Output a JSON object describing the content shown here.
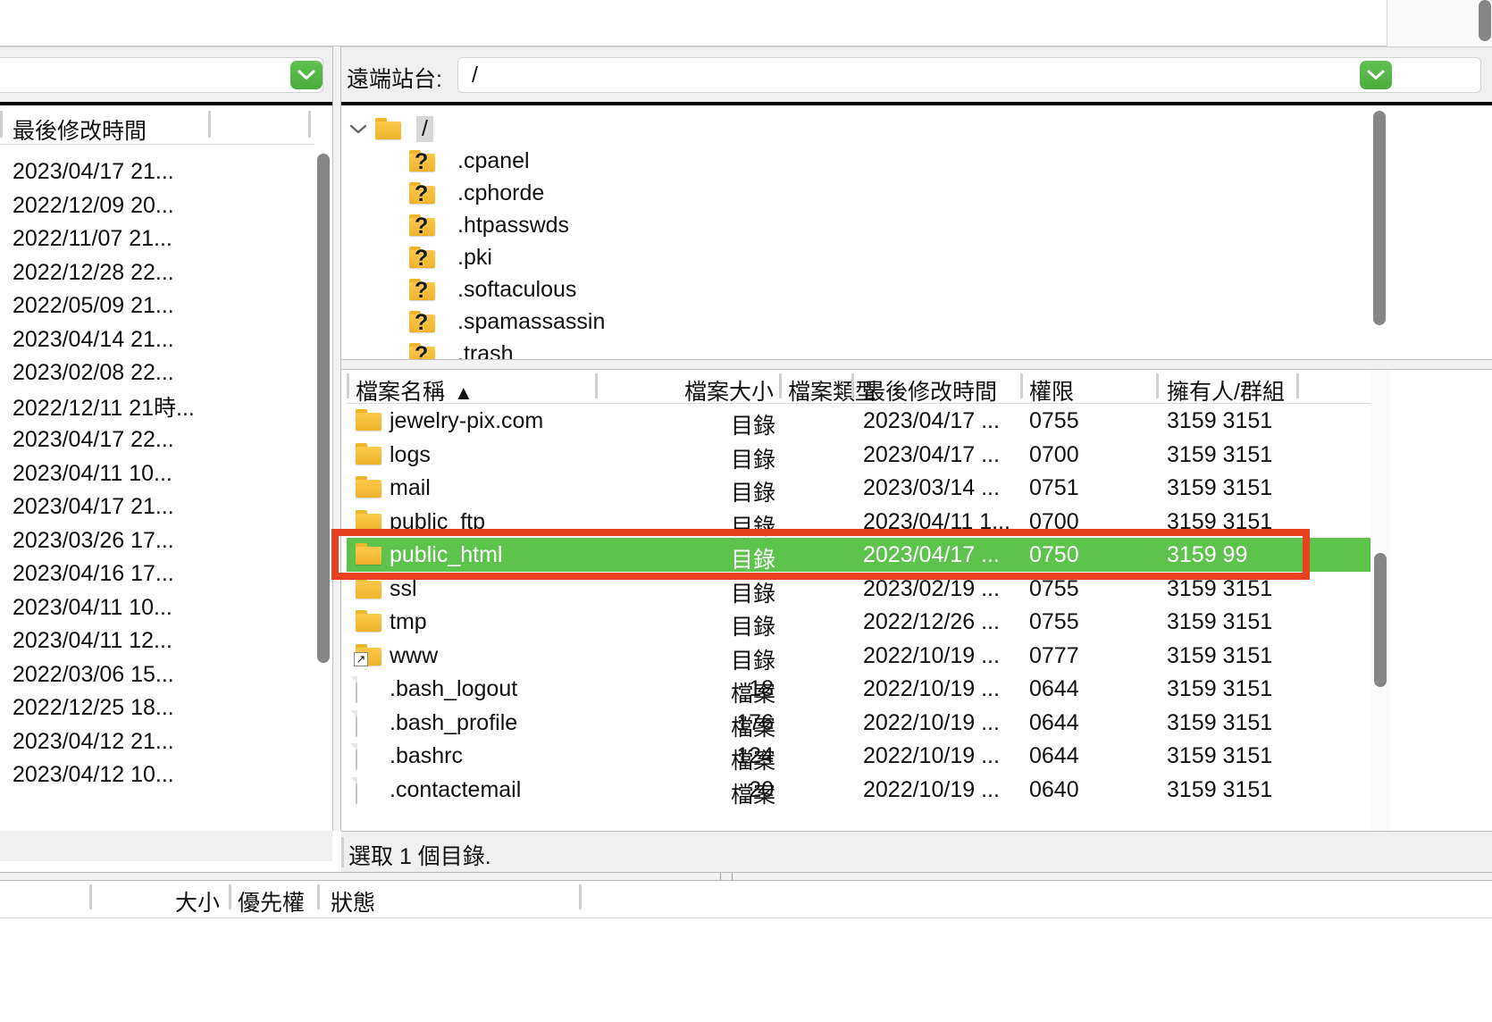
{
  "left_panel": {
    "combo_value": "",
    "dropdown_icon": "chevron-down-icon",
    "column_header": "最後修改時間",
    "rows": [
      "2023/04/17 21...",
      "2022/12/09 20...",
      "2022/11/07 21...",
      "2022/12/28 22...",
      "2022/05/09 21...",
      "2023/04/14 21...",
      "2023/02/08 22...",
      "2022/12/11 21時...",
      "2023/04/17 22...",
      "2023/04/11 10...",
      "2023/04/17 21...",
      "2023/03/26 17...",
      "2023/04/16 17...",
      "2023/04/11 10...",
      "2023/04/11 12...",
      "2022/03/06 15...",
      "2022/12/25 18...",
      "2023/04/12 21...",
      "2023/04/12 10..."
    ]
  },
  "remote": {
    "label": "遠端站台:",
    "path": "/",
    "dropdown_icon": "chevron-down-icon",
    "tree": [
      {
        "name": "/",
        "icon": "folder-icon",
        "selected": true,
        "expanded": true,
        "depth": 0
      },
      {
        "name": ".cpanel",
        "icon": "folder-unknown-icon",
        "selected": false,
        "depth": 1
      },
      {
        "name": ".cphorde",
        "icon": "folder-unknown-icon",
        "selected": false,
        "depth": 1
      },
      {
        "name": ".htpasswds",
        "icon": "folder-unknown-icon",
        "selected": false,
        "depth": 1
      },
      {
        "name": ".pki",
        "icon": "folder-unknown-icon",
        "selected": false,
        "depth": 1
      },
      {
        "name": ".softaculous",
        "icon": "folder-unknown-icon",
        "selected": false,
        "depth": 1
      },
      {
        "name": ".spamassassin",
        "icon": "folder-unknown-icon",
        "selected": false,
        "depth": 1
      },
      {
        "name": ".trash",
        "icon": "folder-unknown-icon",
        "selected": false,
        "depth": 1
      }
    ]
  },
  "file_list": {
    "columns": {
      "name": "檔案名稱",
      "size": "檔案大小",
      "type": "檔案類型",
      "modified": "最後修改時間",
      "permissions": "權限",
      "owner": "擁有人/群組"
    },
    "sort_indicator": "▲",
    "sort_column": "檔案名稱",
    "rows": [
      {
        "icon": "folder-icon",
        "name": "jewelry-pix.com",
        "size": "",
        "type": "目錄",
        "modified": "2023/04/17 ...",
        "permissions": "0755",
        "owner": "3159 3151",
        "selected": false
      },
      {
        "icon": "folder-icon",
        "name": "logs",
        "size": "",
        "type": "目錄",
        "modified": "2023/04/17 ...",
        "permissions": "0700",
        "owner": "3159 3151",
        "selected": false
      },
      {
        "icon": "folder-icon",
        "name": "mail",
        "size": "",
        "type": "目錄",
        "modified": "2023/03/14 ...",
        "permissions": "0751",
        "owner": "3159 3151",
        "selected": false
      },
      {
        "icon": "folder-icon",
        "name": "public_ftp",
        "size": "",
        "type": "目錄",
        "modified": "2023/04/11 1...",
        "permissions": "0700",
        "owner": "3159 3151",
        "selected": false
      },
      {
        "icon": "folder-icon",
        "name": "public_html",
        "size": "",
        "type": "目錄",
        "modified": "2023/04/17 ...",
        "permissions": "0750",
        "owner": "3159 99",
        "selected": true
      },
      {
        "icon": "folder-icon",
        "name": "ssl",
        "size": "",
        "type": "目錄",
        "modified": "2023/02/19 ...",
        "permissions": "0755",
        "owner": "3159 3151",
        "selected": false
      },
      {
        "icon": "folder-icon",
        "name": "tmp",
        "size": "",
        "type": "目錄",
        "modified": "2022/12/26 ...",
        "permissions": "0755",
        "owner": "3159 3151",
        "selected": false
      },
      {
        "icon": "folder-symlink-icon",
        "name": "www",
        "size": "",
        "type": "目錄",
        "modified": "2022/10/19 ...",
        "permissions": "0777",
        "owner": "3159 3151",
        "selected": false
      },
      {
        "icon": "file-icon",
        "name": ".bash_logout",
        "size": "18",
        "type": "檔案",
        "modified": "2022/10/19 ...",
        "permissions": "0644",
        "owner": "3159 3151",
        "selected": false
      },
      {
        "icon": "file-icon",
        "name": ".bash_profile",
        "size": "176",
        "type": "檔案",
        "modified": "2022/10/19 ...",
        "permissions": "0644",
        "owner": "3159 3151",
        "selected": false
      },
      {
        "icon": "file-icon",
        "name": ".bashrc",
        "size": "124",
        "type": "檔案",
        "modified": "2022/10/19 ...",
        "permissions": "0644",
        "owner": "3159 3151",
        "selected": false
      },
      {
        "icon": "file-icon",
        "name": ".contactemail",
        "size": "20",
        "type": "檔案",
        "modified": "2022/10/19 ...",
        "permissions": "0640",
        "owner": "3159 3151",
        "selected": false
      }
    ]
  },
  "status_bar": {
    "text": "選取 1 個目錄."
  },
  "transfer_queue": {
    "columns": {
      "size": "大小",
      "priority": "優先權",
      "status": "狀態"
    }
  },
  "colors": {
    "selection_green": "#5ec34d",
    "annotation_red": "#e8411f",
    "accent_green": "#4aac3c"
  }
}
